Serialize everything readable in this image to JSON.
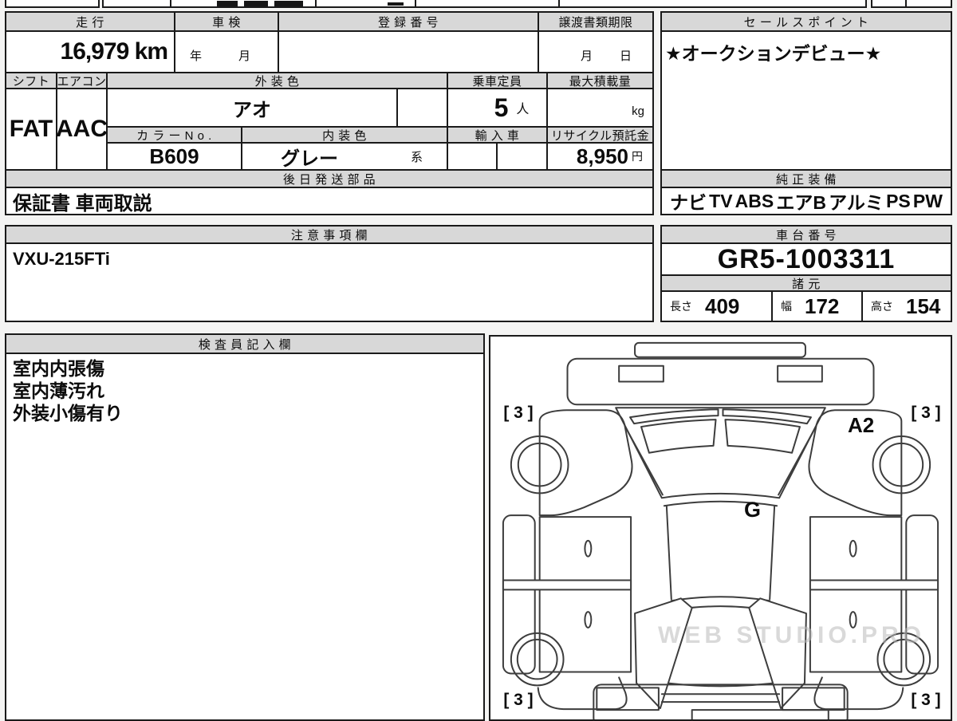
{
  "watermark": "WEB STUDIO.PRO",
  "table": {
    "mileage": {
      "label": "走 行",
      "value": "16,979 km"
    },
    "inspection": {
      "label": "車 検",
      "year": "年",
      "month": "月"
    },
    "registration": {
      "label": "登 録 番 号"
    },
    "transfer": {
      "label": "譲渡書類期限",
      "month": "月",
      "day": "日"
    },
    "shift": {
      "label": "シフト",
      "value": "FAT"
    },
    "aircon": {
      "label": "エアコン",
      "value": "AAC"
    },
    "exterior": {
      "label": "外 装 色",
      "value": "アオ"
    },
    "capacity": {
      "label": "乗車定員",
      "value": "5",
      "unit": "人"
    },
    "payload": {
      "label": "最大積載量",
      "unit": "kg"
    },
    "color_no": {
      "label": "カ ラ ー N o .",
      "value": "B609"
    },
    "interior": {
      "label": "内 装 色",
      "value": "グレー",
      "suffix": "系"
    },
    "import": {
      "label": "輸 入 車"
    },
    "recycle": {
      "label": "リサイクル預託金",
      "value": "8,950",
      "unit": "円"
    },
    "shipping": {
      "label": "後 日 発 送 部 品",
      "value": "保証書 車両取説"
    }
  },
  "sales": {
    "label": "セ ー ル ス ポ イ ン ト",
    "value": "★オークションデビュー★"
  },
  "equipment": {
    "label": "純 正 装 備",
    "items": [
      "ナビ",
      "TV",
      "ABS",
      "エアB",
      "アルミ",
      "PS",
      "PW"
    ]
  },
  "notes": {
    "label": "注 意 事 項 欄",
    "value": "VXU-215FTi"
  },
  "chassis": {
    "label": "車 台 番 号",
    "value": "GR5-1003311"
  },
  "specs": {
    "label": "諸 元",
    "length": {
      "label": "長さ",
      "value": "409"
    },
    "width": {
      "label": "幅",
      "value": "172"
    },
    "height": {
      "label": "高さ",
      "value": "154"
    }
  },
  "inspector": {
    "label": "検 査 員 記 入 欄",
    "lines": [
      "室内内張傷",
      "室内薄汚れ",
      "外装小傷有り"
    ]
  },
  "diagram": {
    "tire_front_left": "[ 3 ]",
    "tire_front_right": "[ 3 ]",
    "tire_rear_left": "[ 3 ]",
    "tire_rear_right": "[ 3 ]",
    "damage_a2": "A2",
    "damage_g": "G"
  }
}
